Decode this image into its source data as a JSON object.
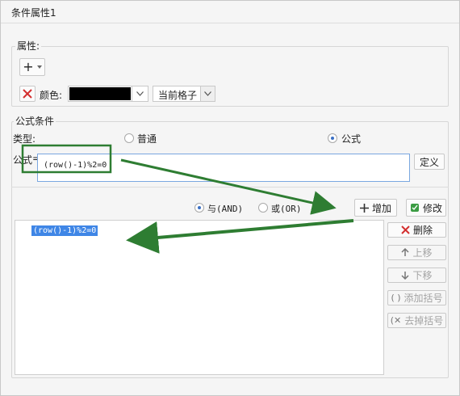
{
  "window": {
    "title": "条件属性1"
  },
  "attributes": {
    "legend": "属性:",
    "add_symbol": "+",
    "color_label": "颜色:",
    "color_value": "#000000",
    "target_value": "当前格子"
  },
  "formula_condition": {
    "legend": "公式条件",
    "type_label": "类型:",
    "type_normal": "普通",
    "type_formula": "公式",
    "formula_label": "公式",
    "formula_value": "(row()-1)%2=0",
    "define_button": "定义",
    "and_label": "与(AND)",
    "or_label": "或(OR)",
    "add_button": "增加",
    "modify_button": "修改",
    "list_items": [
      "(row()-1)%2=0"
    ],
    "side_buttons": {
      "delete": "删除",
      "up": "上移",
      "down": "下移",
      "add_paren": "添加括号",
      "remove_paren": "去掉括号"
    }
  },
  "colors": {
    "accent": "#3f86e6",
    "annotation_green": "#2e7d32",
    "delete_red": "#d32f2f"
  }
}
